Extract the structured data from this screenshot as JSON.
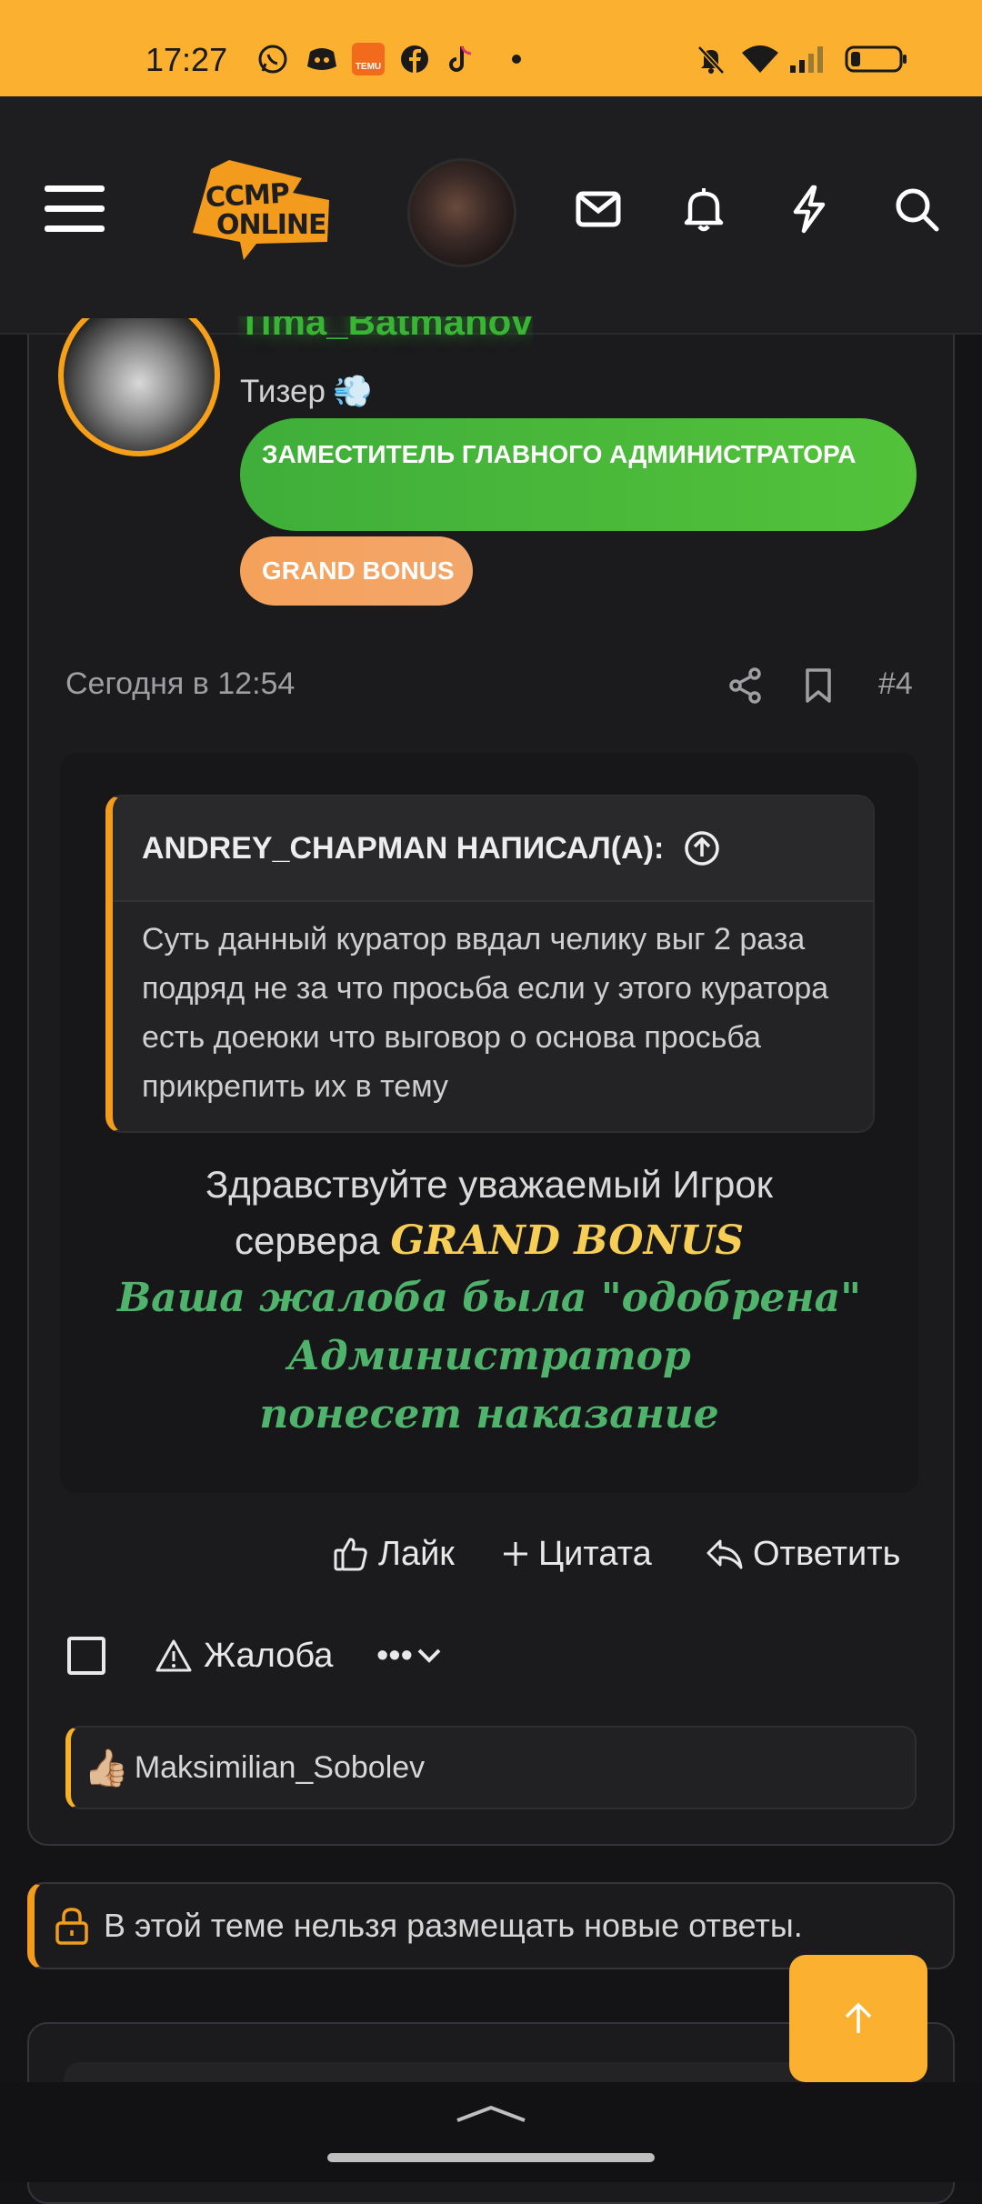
{
  "status_bar": {
    "time": "17:27",
    "app_icons": [
      "whatsapp-icon",
      "discord-icon",
      "temu-icon",
      "facebook-icon",
      "tiktok-icon",
      "dot-icon"
    ],
    "right_icons": [
      "mute-icon",
      "wifi-icon",
      "signal-icon",
      "battery-icon"
    ],
    "temu_label": "TEMU"
  },
  "nav": {
    "logo_line1": "CCMP",
    "logo_line2": "ONLINE",
    "accent": "#fbb12f"
  },
  "post": {
    "username": "Tima_Batmanov",
    "user_title": "Тизер",
    "user_title_emoji": "💨",
    "badge_primary": "ЗАМЕСТИТЕЛЬ ГЛАВНОГО АДМИНИСТРАТОРА",
    "badge_secondary": "GRAND BONUS",
    "date": "Сегодня в 12:54",
    "number": "#4",
    "quote": {
      "author_heading": "ANDREY_CHAPMAN НАПИСАЛ(А):",
      "text": "Суть данный куратор ввдал челику выг 2 раза подряд не за что просьба если у этого куратора есть доеюки что выговор о основа просьба прикрепить их в тему"
    },
    "message": {
      "greeting": "Здравствуйте уважаемый Игрок",
      "server_prefix": "сервера",
      "server_name": "GRAND BONUS",
      "line_approved": "Ваша жалоба была \"одобрена\"",
      "line_punish": "Администратор понесет наказание"
    },
    "actions": {
      "like": "Лайк",
      "quote": "Цитата",
      "reply": "Ответить",
      "report": "Жалоба",
      "more": "•••"
    },
    "likers": {
      "emoji": "👍🏼",
      "names": "Maksimilian_Sobolev"
    }
  },
  "thread_closed_notice": "В этой теме нельзя размещать новые ответы."
}
